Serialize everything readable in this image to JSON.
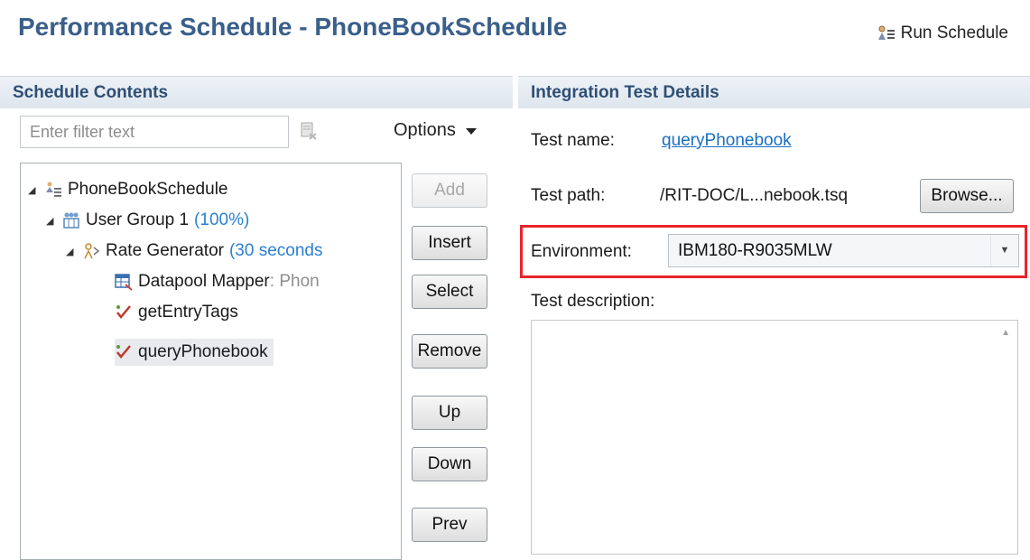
{
  "header": {
    "title": "Performance Schedule - PhoneBookSchedule",
    "run_label": "Run Schedule",
    "run_icon": "run-schedule-icon"
  },
  "left_panel": {
    "title": "Schedule Contents",
    "filter_placeholder": "Enter filter text",
    "options_label": "Options",
    "tree": [
      {
        "label": "PhoneBookSchedule",
        "hint": "",
        "icon": "schedule-icon",
        "expanded": true
      },
      {
        "label": "User Group 1",
        "hint": "(100%)",
        "icon": "user-group-icon",
        "expanded": true
      },
      {
        "label": "Rate Generator",
        "hint": "(30 seconds",
        "icon": "rate-generator-icon",
        "expanded": true
      },
      {
        "label": "Datapool Mapper",
        "hint": ": Phon",
        "icon": "datapool-mapper-icon"
      },
      {
        "label": "getEntryTags",
        "hint": "",
        "icon": "test-icon"
      },
      {
        "label": "queryPhonebook",
        "hint": "",
        "icon": "test-icon",
        "selected": true
      }
    ],
    "buttons": {
      "add": "Add",
      "insert": "Insert",
      "select": "Select",
      "remove": "Remove",
      "up": "Up",
      "down": "Down",
      "prev": "Prev"
    }
  },
  "right_panel": {
    "title": "Integration Test Details",
    "test_name_label": "Test name:",
    "test_name_value": "queryPhonebook",
    "test_path_label": "Test path:",
    "test_path_value": "/RIT-DOC/L...nebook.tsq",
    "browse_label": "Browse...",
    "environment_label": "Environment:",
    "environment_value": "IBM180-R9035MLW",
    "description_label": "Test description:"
  },
  "colors": {
    "title": "#3a5f8a",
    "highlight_border": "#e8242b",
    "link": "#1a6fc2",
    "hint": "#2a7fd4"
  }
}
